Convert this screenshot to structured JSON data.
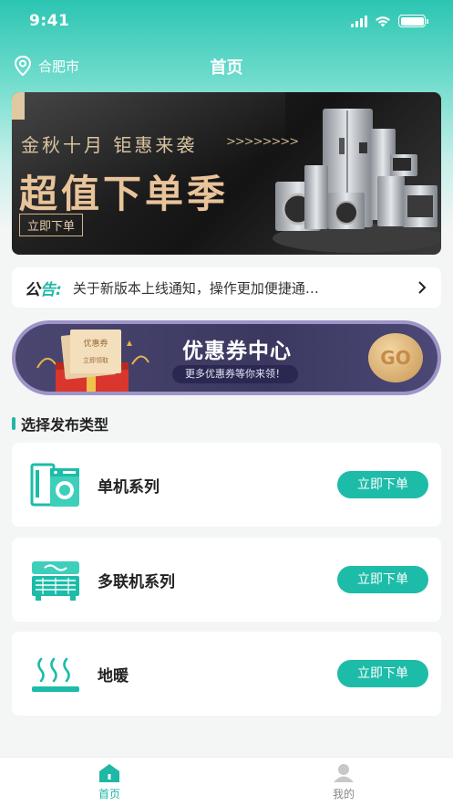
{
  "status_bar": {
    "time": "9:41"
  },
  "nav": {
    "location": "合肥市",
    "title": "首页"
  },
  "banner": {
    "subtitle": "金秋十月 钜惠来袭",
    "arrows": ">>>>>>>>",
    "headline": "超值下单季",
    "button_label": "立即下单"
  },
  "notice": {
    "tag_part1": "公",
    "tag_part2": "告:",
    "text": "关于新版本上线通知，操作更加便捷通…"
  },
  "coupon": {
    "title": "优惠券中心",
    "subtitle": "更多优惠券等你来领！",
    "go_label": "GO",
    "ticket_label": "优惠券",
    "ticket_sub": "立即领取"
  },
  "section": {
    "title": "选择发布类型"
  },
  "categories": [
    {
      "label": "单机系列",
      "button": "立即下单",
      "icon": "washer-icon"
    },
    {
      "label": "多联机系列",
      "button": "立即下单",
      "icon": "hvac-unit-icon"
    },
    {
      "label": "地暖",
      "button": "立即下单",
      "icon": "floor-heating-icon"
    }
  ],
  "tabs": [
    {
      "label": "首页",
      "icon": "home-icon",
      "active": true
    },
    {
      "label": "我的",
      "icon": "profile-icon",
      "active": false
    }
  ],
  "colors": {
    "accent": "#1dbca8",
    "banner_gold": "#e9c39a",
    "coupon_purple": "#3b3860"
  }
}
